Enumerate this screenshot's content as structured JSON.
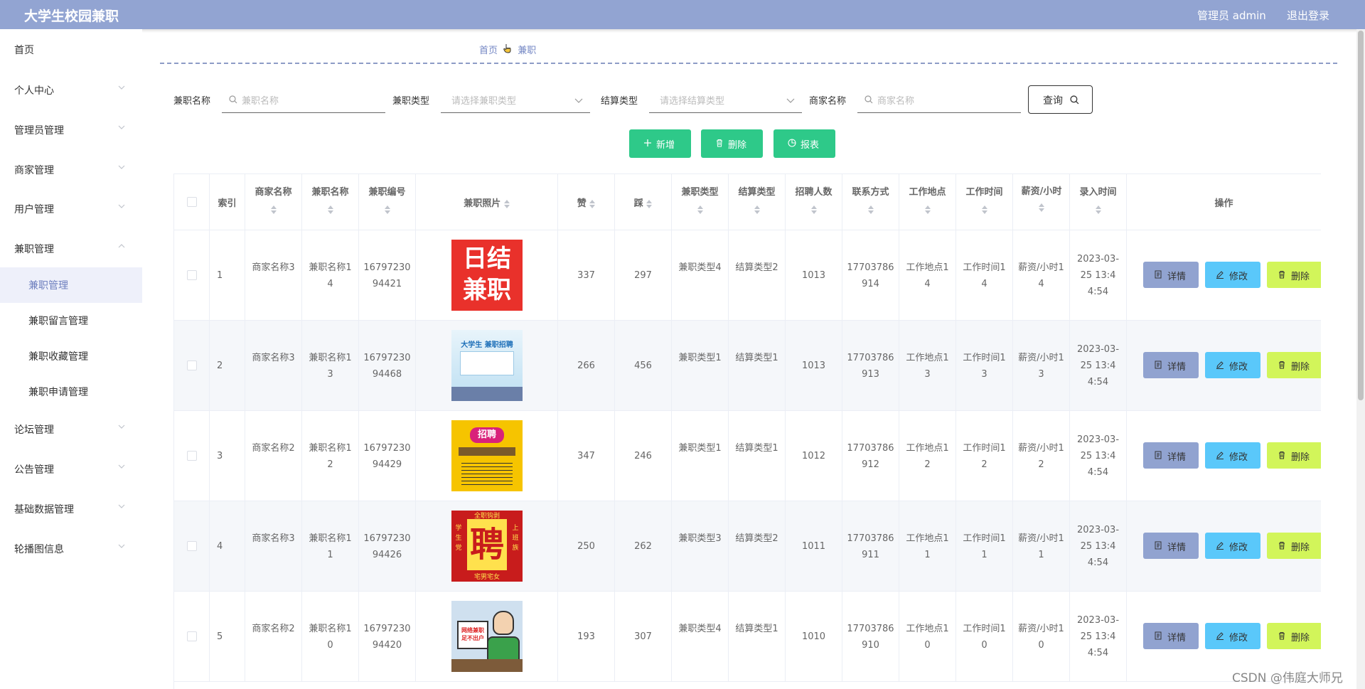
{
  "header": {
    "title": "大学生校园兼职",
    "user": "管理员 admin",
    "logout": "退出登录"
  },
  "sidebar": {
    "items": [
      {
        "label": "首页"
      },
      {
        "label": "个人中心"
      },
      {
        "label": "管理员管理"
      },
      {
        "label": "商家管理"
      },
      {
        "label": "用户管理"
      },
      {
        "label": "兼职管理"
      },
      {
        "label": "论坛管理"
      },
      {
        "label": "公告管理"
      },
      {
        "label": "基础数据管理"
      },
      {
        "label": "轮播图信息"
      }
    ],
    "subitems": [
      {
        "label": "兼职管理"
      },
      {
        "label": "兼职留言管理"
      },
      {
        "label": "兼职收藏管理"
      },
      {
        "label": "兼职申请管理"
      }
    ]
  },
  "breadcrumb": {
    "home": "首页",
    "current": "兼职"
  },
  "filters": {
    "name_label": "兼职名称",
    "name_placeholder": "兼职名称",
    "type_label": "兼职类型",
    "type_placeholder": "请选择兼职类型",
    "settle_label": "结算类型",
    "settle_placeholder": "请选择结算类型",
    "merchant_label": "商家名称",
    "merchant_placeholder": "商家名称",
    "query": "查询"
  },
  "actions": {
    "add": "新增",
    "delete": "删除",
    "report": "报表"
  },
  "table": {
    "headers": [
      "索引",
      "商家名称",
      "兼职名称",
      "兼职编号",
      "兼职照片",
      "赞",
      "踩",
      "兼职类型",
      "结算类型",
      "招聘人数",
      "联系方式",
      "工作地点",
      "工作时间",
      "薪资/小时",
      "录入时间",
      "操作"
    ],
    "rows": [
      {
        "index": "1",
        "merchant": "商家名称3",
        "name": "兼职名称14",
        "code": "1679723094421",
        "likes": "337",
        "dislikes": "297",
        "type": "兼职类型4",
        "settle": "结算类型2",
        "count": "1013",
        "phone": "17703786914",
        "place": "工作地点14",
        "time": "工作时间14",
        "salary": "薪资/小时14",
        "created": "2023-03-25 13:44:54"
      },
      {
        "index": "2",
        "merchant": "商家名称3",
        "name": "兼职名称13",
        "code": "1679723094468",
        "likes": "266",
        "dislikes": "456",
        "type": "兼职类型1",
        "settle": "结算类型1",
        "count": "1013",
        "phone": "17703786913",
        "place": "工作地点13",
        "time": "工作时间13",
        "salary": "薪资/小时13",
        "created": "2023-03-25 13:44:54"
      },
      {
        "index": "3",
        "merchant": "商家名称2",
        "name": "兼职名称12",
        "code": "1679723094429",
        "likes": "347",
        "dislikes": "246",
        "type": "兼职类型1",
        "settle": "结算类型1",
        "count": "1012",
        "phone": "17703786912",
        "place": "工作地点12",
        "time": "工作时间12",
        "salary": "薪资/小时12",
        "created": "2023-03-25 13:44:54"
      },
      {
        "index": "4",
        "merchant": "商家名称3",
        "name": "兼职名称11",
        "code": "1679723094426",
        "likes": "250",
        "dislikes": "262",
        "type": "兼职类型3",
        "settle": "结算类型2",
        "count": "1011",
        "phone": "17703786911",
        "place": "工作地点11",
        "time": "工作时间11",
        "salary": "薪资/小时11",
        "created": "2023-03-25 13:44:54"
      },
      {
        "index": "5",
        "merchant": "商家名称2",
        "name": "兼职名称10",
        "code": "1679723094420",
        "likes": "193",
        "dislikes": "307",
        "type": "兼职类型4",
        "settle": "结算类型1",
        "count": "1010",
        "phone": "17703786910",
        "place": "工作地点10",
        "time": "工作时间10",
        "salary": "薪资/小时10",
        "created": "2023-03-25 13:44:54"
      }
    ],
    "op_detail": "详情",
    "op_edit": "修改",
    "op_delete": "删除"
  },
  "thumbs": {
    "t1_line1": "日结",
    "t1_line2": "兼职",
    "t2_title": "大学生 兼职招聘",
    "t3_title": "招聘",
    "t4_top": "全职钩剥",
    "t4_main": "聘",
    "t4_left": "学生党",
    "t4_right": "上班族",
    "t4_bottom": "宅男宅女",
    "t5_sign": "网络兼职 足不出户"
  },
  "watermark": "CSDN @伟庭大师兄",
  "colors": {
    "header": "#92a4d2",
    "green": "#2ec989",
    "detail": "#91a3d0",
    "edit": "#5ac8fa",
    "delete": "#d2f55a"
  }
}
